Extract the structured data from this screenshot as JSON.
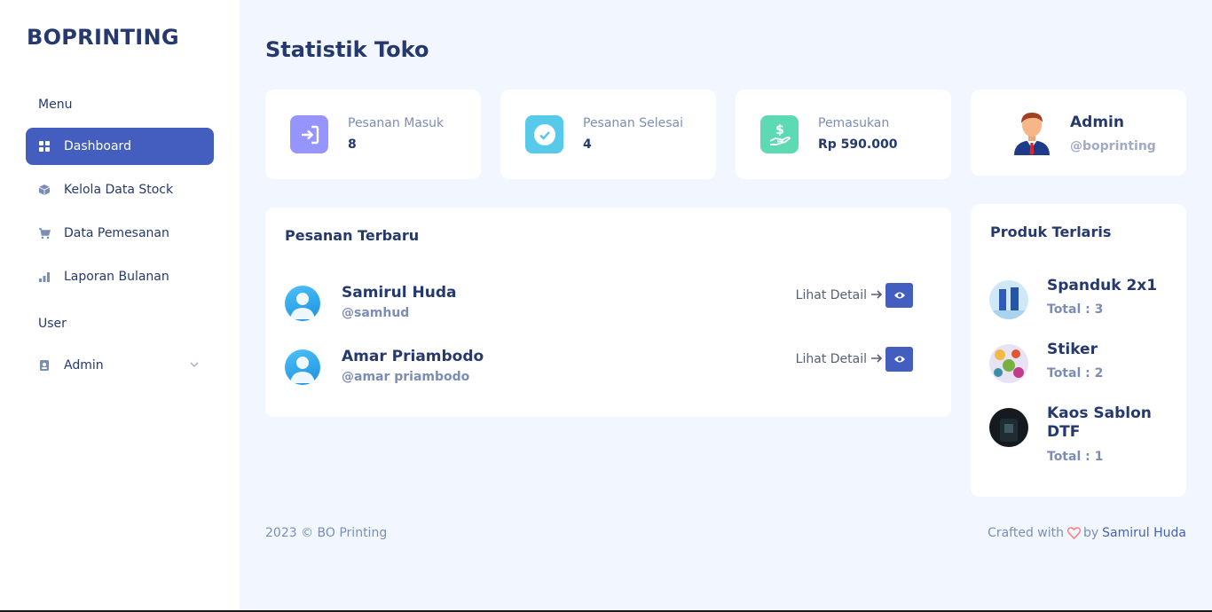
{
  "sidebar": {
    "brand": "BOPRINTING",
    "menu_title": "Menu",
    "items": [
      {
        "label": "Dashboard",
        "icon": "grid-icon"
      },
      {
        "label": "Kelola Data Stock",
        "icon": "box-icon"
      },
      {
        "label": "Data Pemesanan",
        "icon": "cart-icon"
      },
      {
        "label": "Laporan Bulanan",
        "icon": "bar-chart-icon"
      }
    ],
    "user_title": "User",
    "user_item": {
      "label": "Admin",
      "icon": "person-badge-icon"
    }
  },
  "main": {
    "title": "Statistik Toko",
    "stats": [
      {
        "label": "Pesanan Masuk",
        "value": "8",
        "color": "#9694ff"
      },
      {
        "label": "Pesanan Selesai",
        "value": "4",
        "color": "#57caeb"
      },
      {
        "label": "Pemasukan",
        "value": "Rp 590.000",
        "color": "#5ddab4"
      }
    ],
    "profile": {
      "name": "Admin",
      "handle": "@boprinting"
    },
    "recent_orders": {
      "title": "Pesanan Terbaru",
      "detail_label": "Lihat Detail",
      "rows": [
        {
          "name": "Samirul Huda",
          "handle": "@samhud"
        },
        {
          "name": "Amar Priambodo",
          "handle": "@amar priambodo"
        }
      ]
    },
    "top_products": {
      "title": "Produk Terlaris",
      "rows": [
        {
          "name": "Spanduk 2x1",
          "total": "Total : 3"
        },
        {
          "name": "Stiker",
          "total": "Total : 2"
        },
        {
          "name": "Kaos Sablon DTF",
          "total": "Total : 1"
        }
      ]
    }
  },
  "footer": {
    "copyright": "2023 © BO Printing",
    "crafted_prefix": "Crafted with",
    "crafted_by": "by",
    "author": "Samirul Huda"
  },
  "colors": {
    "accent": "#435ebe",
    "text": "#25396f",
    "muted": "#7c8db5",
    "background": "#f2f7ff",
    "heart": "#ff7976"
  }
}
